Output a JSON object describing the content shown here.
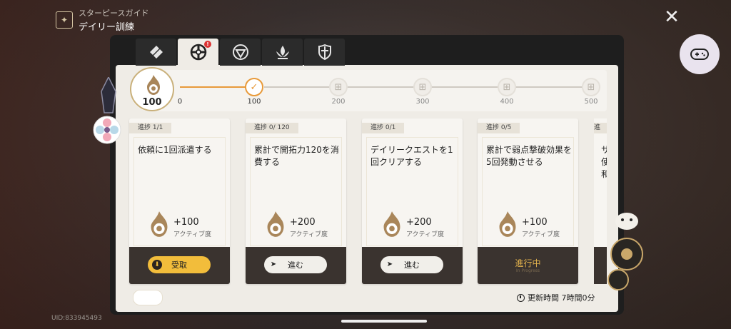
{
  "header": {
    "guide_subtitle": "スターピースガイド",
    "guide_title": "デイリー訓練"
  },
  "footer": {
    "uid": "UID:833945493"
  },
  "tabs": [
    {
      "icon": "tab-icon-1",
      "active": false,
      "badge": ""
    },
    {
      "icon": "tab-icon-daily",
      "active": true,
      "badge": "!"
    },
    {
      "icon": "tab-icon-3",
      "active": false,
      "badge": ""
    },
    {
      "icon": "tab-icon-4",
      "active": false,
      "badge": ""
    },
    {
      "icon": "tab-icon-5",
      "active": false,
      "badge": ""
    }
  ],
  "progress": {
    "current": "100",
    "milestones": [
      "0",
      "100",
      "200",
      "300",
      "400",
      "500"
    ]
  },
  "tasks": [
    {
      "progress": "進捗 1/1",
      "desc": "依頼に1回派遣する",
      "reward": "+100",
      "reward_label": "アクティブ度",
      "button": "受取",
      "state": "claim"
    },
    {
      "progress": "進捗 0/ 120",
      "desc": "累計で開拓力120を消費する",
      "reward": "+200",
      "reward_label": "アクティブ度",
      "button": "進む",
      "state": "go"
    },
    {
      "progress": "進捗 0/1",
      "desc": "デイリークエストを1回クリアする",
      "reward": "+200",
      "reward_label": "アクティブ度",
      "button": "進む",
      "state": "go"
    },
    {
      "progress": "進捗 0/5",
      "desc": "累計で弱点撃破効果を5回発動させる",
      "reward": "+100",
      "reward_label": "アクティブ度",
      "button": "進行中",
      "button_sub": "In Progress",
      "state": "inprogress"
    },
    {
      "progress": "進",
      "desc": "サ 使 和",
      "state": "peek"
    }
  ],
  "refresh": "更新時間 7時間0分",
  "colors": {
    "accent": "#e89a3a",
    "claim": "#f2bd3b",
    "card_footer": "#3a332f",
    "panel": "#1e1e1e"
  }
}
